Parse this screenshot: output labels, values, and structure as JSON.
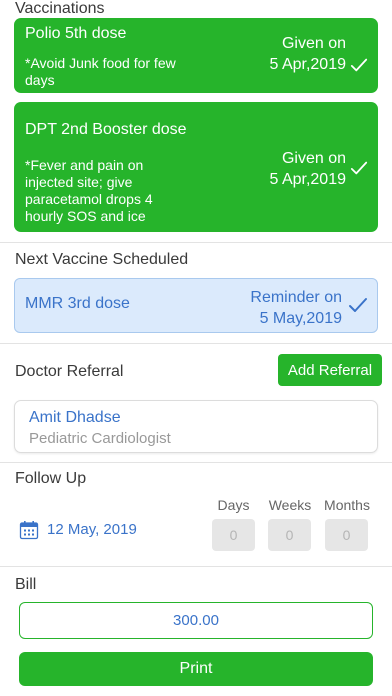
{
  "vaccinations": {
    "title": "Vaccinations",
    "items": [
      {
        "name": "Polio 5th dose",
        "note": "*Avoid Junk food for few days",
        "status_line1": "Given on",
        "status_line2": "5 Apr,2019"
      },
      {
        "name": "DPT 2nd Booster dose",
        "note": "*Fever and pain on injected site; give paracetamol drops 4 hourly SOS and ice",
        "status_line1": "Given on",
        "status_line2": "5 Apr,2019"
      }
    ]
  },
  "next_vaccine": {
    "title": "Next Vaccine Scheduled",
    "name": "MMR 3rd dose",
    "status_line1": "Reminder on",
    "status_line2": "5 May,2019"
  },
  "doctor_referral": {
    "title": "Doctor Referral",
    "add_label": "Add Referral",
    "doctor_name": "Amit Dhadse",
    "specialty": "Pediatric Cardiologist"
  },
  "follow_up": {
    "title": "Follow Up",
    "date": "12 May, 2019",
    "days_label": "Days",
    "weeks_label": "Weeks",
    "months_label": "Months",
    "days_value": "0",
    "weeks_value": "0",
    "months_value": "0"
  },
  "bill": {
    "title": "Bill",
    "amount": "300.00",
    "print_label": "Print"
  },
  "colors": {
    "accent_green": "#26b42b",
    "link_blue": "#3a73c9",
    "reminder_bg": "#dbeafc"
  }
}
